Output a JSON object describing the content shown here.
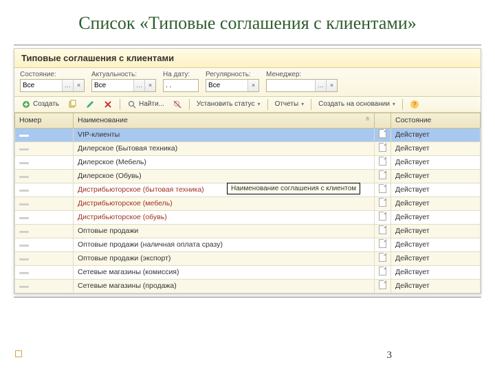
{
  "slide": {
    "title": "Список «Типовые соглашения с клиентами»",
    "page": "3"
  },
  "header": {
    "title": "Типовые соглашения с клиентами"
  },
  "filters": {
    "state": {
      "label": "Состояние:",
      "value": "Все"
    },
    "relevance": {
      "label": "Актуальность:",
      "value": "Все"
    },
    "date": {
      "label": "На дату:",
      "value": ". ."
    },
    "regularity": {
      "label": "Регулярность:",
      "value": "Все"
    },
    "manager": {
      "label": "Менеджер:",
      "value": ""
    }
  },
  "toolbar": {
    "create": "Создать",
    "find": "Найти...",
    "set_status": "Установить статус",
    "reports": "Отчеты",
    "create_on_basis": "Создать на основании"
  },
  "columns": {
    "number": "Номер",
    "name": "Наименование",
    "state": "Состояние"
  },
  "rows": [
    {
      "name": "VIP-клиенты",
      "state": "Действует",
      "selected": true,
      "red": false
    },
    {
      "name": "Дилерское (Бытовая техника)",
      "state": "Действует",
      "selected": false,
      "red": false
    },
    {
      "name": "Дилерское (Мебель)",
      "state": "Действует",
      "selected": false,
      "red": false
    },
    {
      "name": "Дилерское (Обувь)",
      "state": "Действует",
      "selected": false,
      "red": false
    },
    {
      "name": "Дистрибьюторское (бытовая техника)",
      "state": "Действует",
      "selected": false,
      "red": true
    },
    {
      "name": "Дистрибьюторское (мебель)",
      "state": "Действует",
      "selected": false,
      "red": true
    },
    {
      "name": "Дистрибьюторское (обувь)",
      "state": "Действует",
      "selected": false,
      "red": true
    },
    {
      "name": "Оптовые продажи",
      "state": "Действует",
      "selected": false,
      "red": false
    },
    {
      "name": "Оптовые продажи (наличная оплата сразу)",
      "state": "Действует",
      "selected": false,
      "red": false
    },
    {
      "name": "Оптовые продажи (экспорт)",
      "state": "Действует",
      "selected": false,
      "red": false
    },
    {
      "name": "Сетевые магазины (комиссия)",
      "state": "Действует",
      "selected": false,
      "red": false
    },
    {
      "name": "Сетевые магазины (продажа)",
      "state": "Действует",
      "selected": false,
      "red": false
    }
  ],
  "tooltip": "Наименование соглашения с клиентом"
}
